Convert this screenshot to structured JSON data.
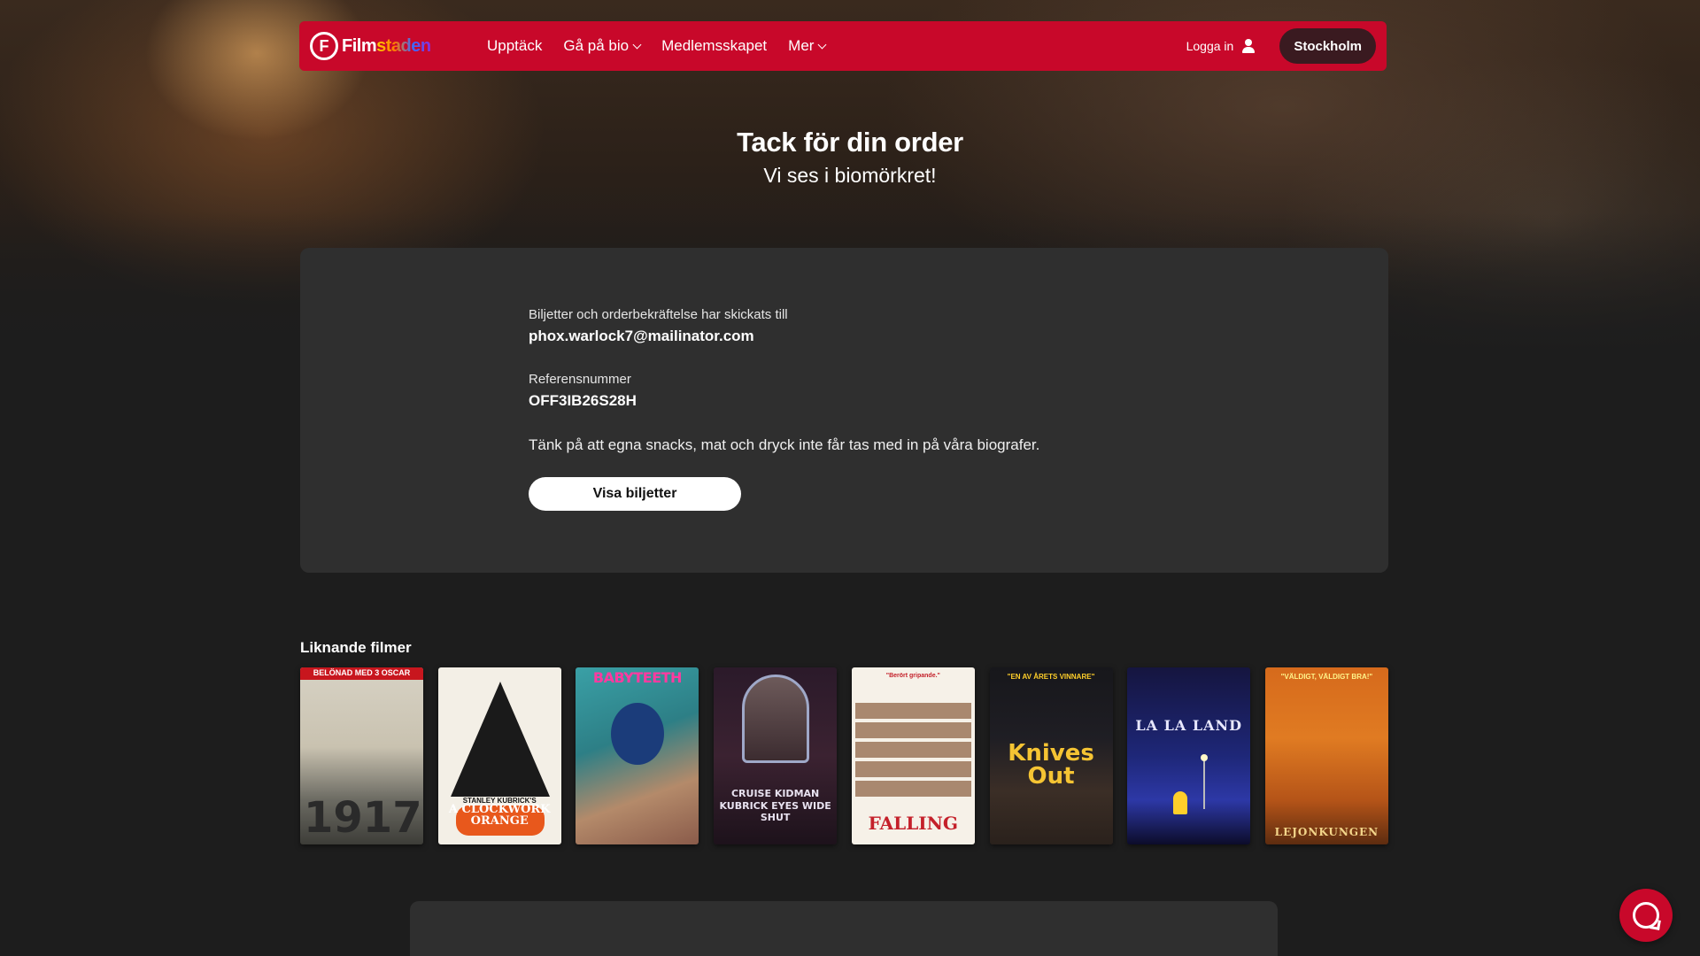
{
  "header": {
    "logo_text_prefix": "Film",
    "logo_text_suffix": "staden",
    "nav": [
      {
        "label": "Upptäck",
        "has_dropdown": false
      },
      {
        "label": "Gå på bio",
        "has_dropdown": true
      },
      {
        "label": "Medlemsskapet",
        "has_dropdown": false
      },
      {
        "label": "Mer",
        "has_dropdown": true
      }
    ],
    "login_label": "Logga in",
    "city_label": "Stockholm",
    "accent_color": "#c8082a"
  },
  "hero": {
    "title": "Tack för din order",
    "subtitle": "Vi ses i biomörkret!"
  },
  "confirmation": {
    "sent_to_label": "Biljetter och orderbekräftelse har skickats till",
    "email": "phox.warlock7@mailinator.com",
    "reference_label": "Referensnummer",
    "reference": "OFF3IB26S28H",
    "note": "Tänk på att egna snacks, mat och dryck inte får tas med in på våra biografer.",
    "show_tickets_label": "Visa biljetter"
  },
  "similar": {
    "title": "Liknande filmer",
    "posters": [
      {
        "top": "BELÖNAD MED 3 OSCAR",
        "title": "1917"
      },
      {
        "top": "STANLEY KUBRICK'S",
        "title": "A CLOCKWORK ORANGE"
      },
      {
        "top": "BABYTEETH",
        "title": ""
      },
      {
        "top": "",
        "title": "CRUISE KIDMAN KUBRICK EYES WIDE SHUT"
      },
      {
        "top": "\"Berört gripande.\"",
        "title": "FALLING"
      },
      {
        "top": "\"EN AV ÅRETS VINNARE\"",
        "title": "Knives Out"
      },
      {
        "top": "",
        "title": "LA LA LAND"
      },
      {
        "top": "\"VÄLDIGT, VÄLDIGT BRA!\"",
        "title": "LEJONKUNGEN"
      }
    ]
  },
  "chat": {
    "icon": "chat-bubble-icon"
  }
}
